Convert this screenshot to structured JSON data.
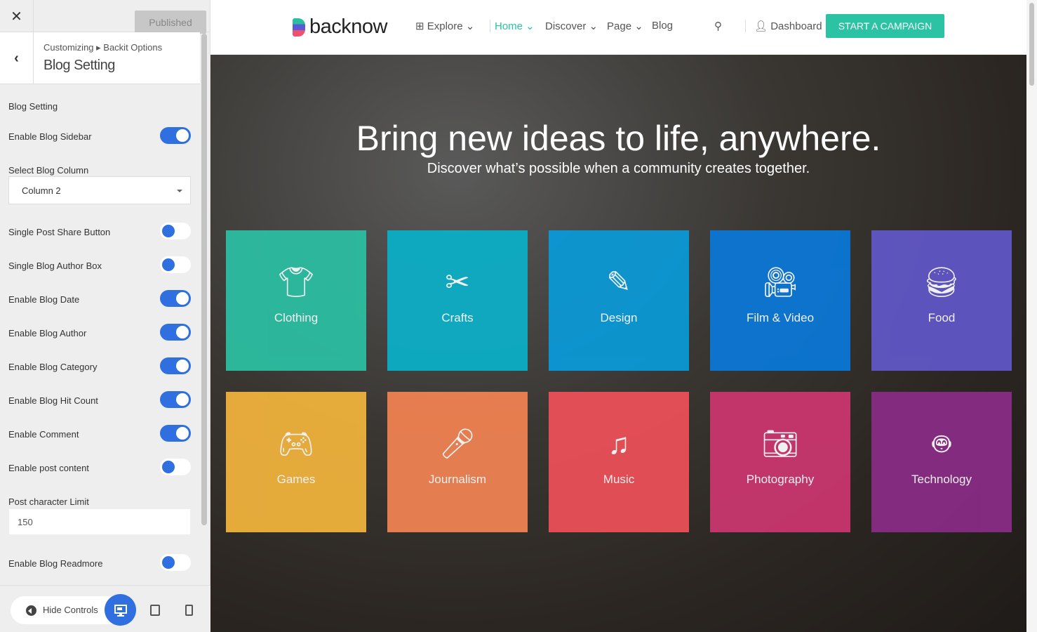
{
  "sidebar": {
    "published": "Published",
    "breadcrumb": "Customizing ▸ Backit Options",
    "title": "Blog Setting",
    "section": "Blog Setting",
    "items": [
      {
        "label": "Enable Blog Sidebar",
        "type": "toggle",
        "on": true
      },
      {
        "label": "Select Blog Column",
        "type": "select",
        "value": "Column 2"
      },
      {
        "label": "Single Post Share Button",
        "type": "toggle",
        "on": false
      },
      {
        "label": "Single Blog Author Box",
        "type": "toggle",
        "on": false
      },
      {
        "label": "Enable Blog Date",
        "type": "toggle",
        "on": true
      },
      {
        "label": "Enable Blog Author",
        "type": "toggle",
        "on": true
      },
      {
        "label": "Enable Blog Category",
        "type": "toggle",
        "on": true
      },
      {
        "label": "Enable Blog Hit Count",
        "type": "toggle",
        "on": true
      },
      {
        "label": "Enable Comment",
        "type": "toggle",
        "on": true
      },
      {
        "label": "Enable post content",
        "type": "toggle",
        "on": false
      },
      {
        "label": "Post character Limit",
        "type": "input",
        "value": "150"
      },
      {
        "label": "Enable Blog Readmore",
        "type": "toggle",
        "on": false
      }
    ],
    "hide_controls": "Hide Controls"
  },
  "nav": {
    "logo": "backnow",
    "items": [
      "Explore",
      "Home",
      "Discover",
      "Page",
      "Blog"
    ],
    "dashboard": "Dashboard",
    "cta": "START A CAMPAIGN",
    "accent": "#2bc3a4"
  },
  "hero": {
    "title": "Bring new ideas to life, anywhere.",
    "subtitle": "Discover what’s possible when a community creates together."
  },
  "categories": [
    {
      "label": "Clothing",
      "icon": "shirt-icon",
      "color": "#2bbfa3"
    },
    {
      "label": "Crafts",
      "icon": "crafts-icon",
      "color": "#0bb0c8"
    },
    {
      "label": "Design",
      "icon": "design-icon",
      "color": "#0a9ad8"
    },
    {
      "label": "Film & Video",
      "icon": "camera-video-icon",
      "color": "#0a78d8"
    },
    {
      "label": "Food",
      "icon": "food-icon",
      "color": "#6157c8"
    },
    {
      "label": "Games",
      "icon": "gamepad-icon",
      "color": "#f2b43c"
    },
    {
      "label": "Journalism",
      "icon": "microphone-icon",
      "color": "#f28352"
    },
    {
      "label": "Music",
      "icon": "music-icon",
      "color": "#ee5058"
    },
    {
      "label": "Photography",
      "icon": "camera-icon",
      "color": "#cc3670"
    },
    {
      "label": "Technology",
      "icon": "robot-icon",
      "color": "#8a2c86"
    }
  ]
}
